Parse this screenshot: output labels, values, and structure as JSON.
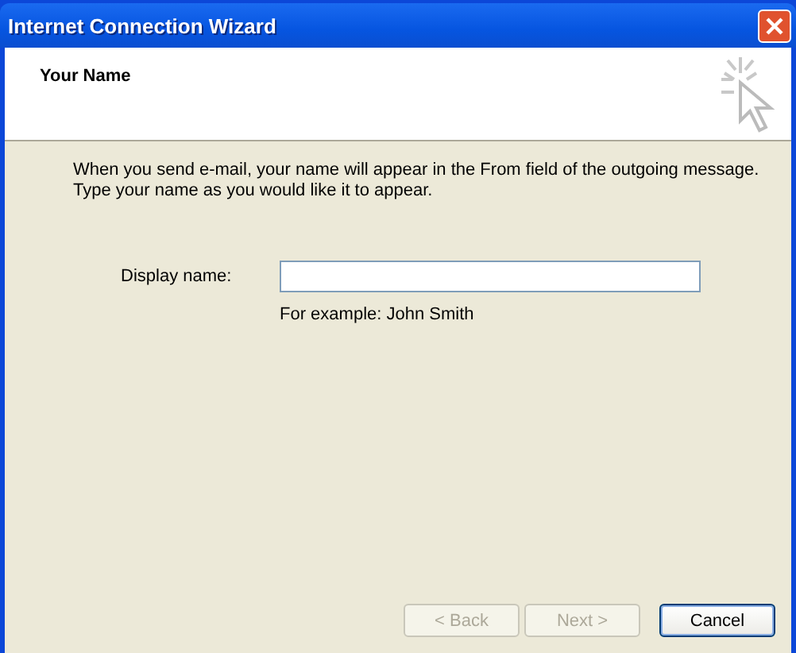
{
  "window": {
    "title": "Internet Connection Wizard"
  },
  "header": {
    "title": "Your Name"
  },
  "intro": "When you send e-mail, your name will appear in the From field of the outgoing message.\nType your name as you would like it to appear.",
  "display_name": {
    "label": "Display name:",
    "hint": "For example: John Smith"
  },
  "buttons": [
    {
      "label": "< Back",
      "disabled": true,
      "default": false
    },
    {
      "label": "Next >",
      "disabled": true,
      "default": false
    },
    {
      "label": "Cancel",
      "disabled": false,
      "default": true
    }
  ]
}
